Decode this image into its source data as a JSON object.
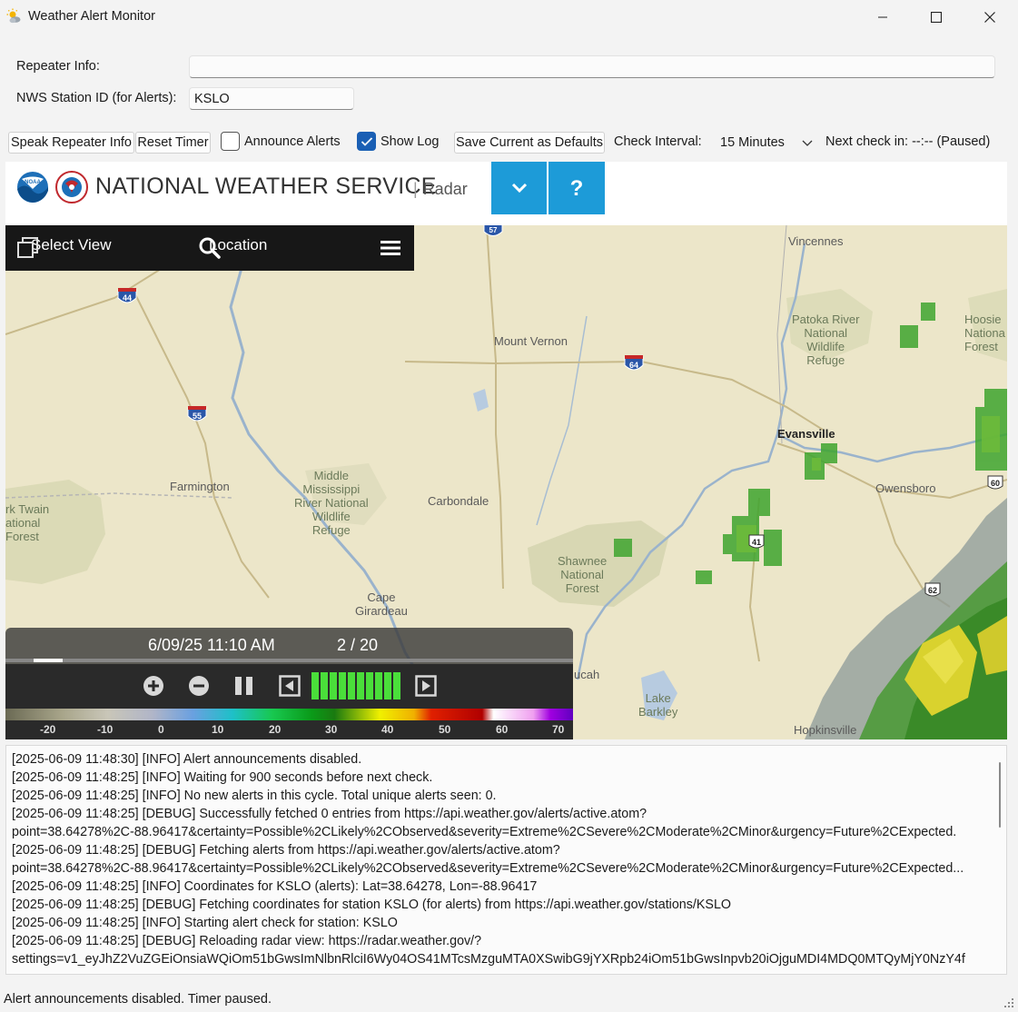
{
  "window": {
    "title": "Weather Alert Monitor",
    "icon": "sun-cloud-icon"
  },
  "form": {
    "repeater_label": "Repeater Info:",
    "repeater_value": "",
    "station_label": "NWS Station ID (for Alerts):",
    "station_value": "KSLO"
  },
  "toolbar": {
    "speak_label": "Speak Repeater Info",
    "reset_label": "Reset Timer",
    "announce_label": "Announce Alerts",
    "announce_checked": false,
    "showlog_label": "Show Log",
    "showlog_checked": true,
    "save_label": "Save Current as Defaults",
    "interval_label": "Check Interval:",
    "interval_value": "15 Minutes",
    "next_check_text": "Next check in: --:-- (Paused)"
  },
  "nws": {
    "title": "NATIONAL WEATHER SERVICE",
    "separator": "|",
    "subtitle": "Radar",
    "accent": "#1d9bd8"
  },
  "map": {
    "select_view": "Select View",
    "location": "Location",
    "labels": {
      "vincennes": "Vincennes",
      "patoka": [
        "Patoka River",
        "National",
        "Wildlife",
        "Refuge"
      ],
      "hoosier": [
        "Hoosie",
        "Nationa",
        "Forest"
      ],
      "mount_vernon": "Mount Vernon",
      "evansville": "Evansville",
      "owensboro": "Owensboro",
      "farmington": "Farmington",
      "middle_miss": [
        "Middle",
        "Mississippi",
        "River National",
        "Wildlife",
        "Refuge"
      ],
      "carbondale": "Carbondale",
      "mark_twain": [
        "rk Twain",
        "ational",
        "Forest"
      ],
      "shawnee": [
        "Shawnee",
        "National",
        "Forest"
      ],
      "cape": [
        "Cape",
        "Girardeau"
      ],
      "paducah": "ucah",
      "lake_barkley": [
        "Lake",
        "Barkley"
      ],
      "hopkinsville": "Hopkinsville"
    },
    "shields": {
      "i57": "57",
      "i44": "44",
      "i64": "64",
      "i55": "55",
      "us41": "41",
      "us60": "60",
      "us62": "62"
    }
  },
  "animation": {
    "timestamp": "6/09/25 11:10 AM",
    "frame": "2 / 20",
    "progress": 0.1,
    "speed_level": 10
  },
  "legend": {
    "ticks": [
      "-20",
      "-10",
      "0",
      "10",
      "20",
      "30",
      "40",
      "50",
      "60",
      "70"
    ]
  },
  "log": {
    "lines": [
      "[2025-06-09 11:48:30] [INFO] Alert announcements disabled.",
      "[2025-06-09 11:48:25] [INFO] Waiting for 900 seconds before next check.",
      "[2025-06-09 11:48:25] [INFO] No new alerts in this cycle. Total unique alerts seen: 0.",
      "[2025-06-09 11:48:25] [DEBUG] Successfully fetched 0 entries from https://api.weather.gov/alerts/active.atom?",
      "point=38.64278%2C-88.96417&certainty=Possible%2CLikely%2CObserved&severity=Extreme%2CSevere%2CModerate%2CMinor&urgency=Future%2CExpected.",
      "[2025-06-09 11:48:25] [DEBUG] Fetching alerts from https://api.weather.gov/alerts/active.atom?",
      "point=38.64278%2C-88.96417&certainty=Possible%2CLikely%2CObserved&severity=Extreme%2CSevere%2CModerate%2CMinor&urgency=Future%2CExpected...",
      "[2025-06-09 11:48:25] [INFO] Coordinates for KSLO (alerts): Lat=38.64278, Lon=-88.96417",
      "[2025-06-09 11:48:25] [DEBUG] Fetching coordinates for station KSLO (for alerts) from https://api.weather.gov/stations/KSLO",
      "[2025-06-09 11:48:25] [INFO] Starting alert check for station: KSLO",
      "[2025-06-09 11:48:25] [DEBUG] Reloading radar view: https://radar.weather.gov/?",
      "settings=v1_eyJhZ2VuZGEiOnsiaWQiOm51bGwsImNlbnRlciI6Wy04OS41MTcsMzguMTA0XSwibG9jYXRpb24iOm51bGwsInpvb20iOjguMDI4MDQ0MTQyMjY0NzY4f"
    ]
  },
  "status": {
    "text": "Alert announcements disabled. Timer paused."
  }
}
